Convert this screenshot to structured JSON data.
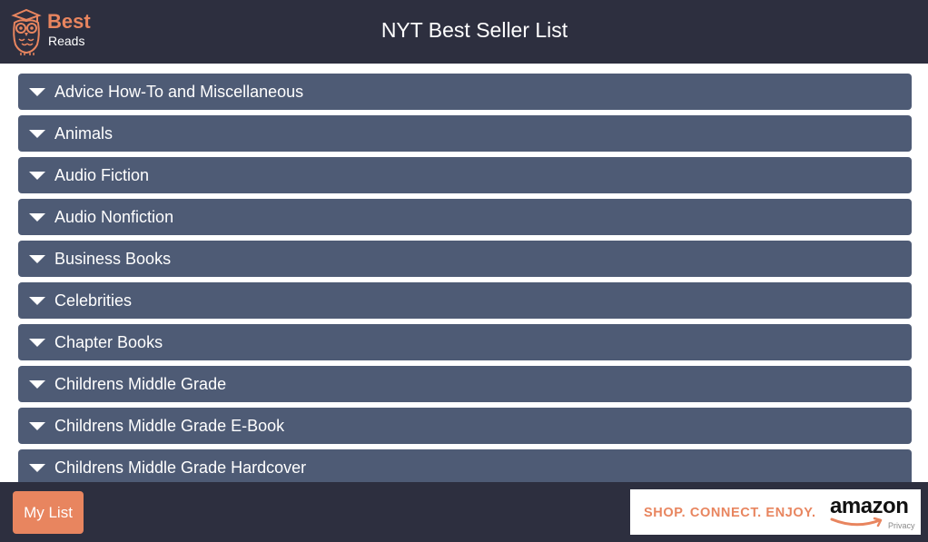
{
  "app": {
    "logo_best": "Best",
    "logo_reads": "Reads",
    "title": "NYT Best Seller List"
  },
  "categories": [
    {
      "label": "Advice How-To and Miscellaneous"
    },
    {
      "label": "Animals"
    },
    {
      "label": "Audio Fiction"
    },
    {
      "label": "Audio Nonfiction"
    },
    {
      "label": "Business Books"
    },
    {
      "label": "Celebrities"
    },
    {
      "label": "Chapter Books"
    },
    {
      "label": "Childrens Middle Grade"
    },
    {
      "label": "Childrens Middle Grade E-Book"
    },
    {
      "label": "Childrens Middle Grade Hardcover"
    }
  ],
  "footer": {
    "my_list_label": "My List",
    "ad": {
      "tagline": "SHOP. CONNECT. ENJOY.",
      "brand": "amazon",
      "privacy": "Privacy"
    }
  },
  "colors": {
    "header_bg": "#2d2f3f",
    "accent": "#e8855f",
    "category_bg": "#4e5b75"
  },
  "icons": {
    "logo": "owl-graduate-icon",
    "expand": "caret-down-icon"
  }
}
